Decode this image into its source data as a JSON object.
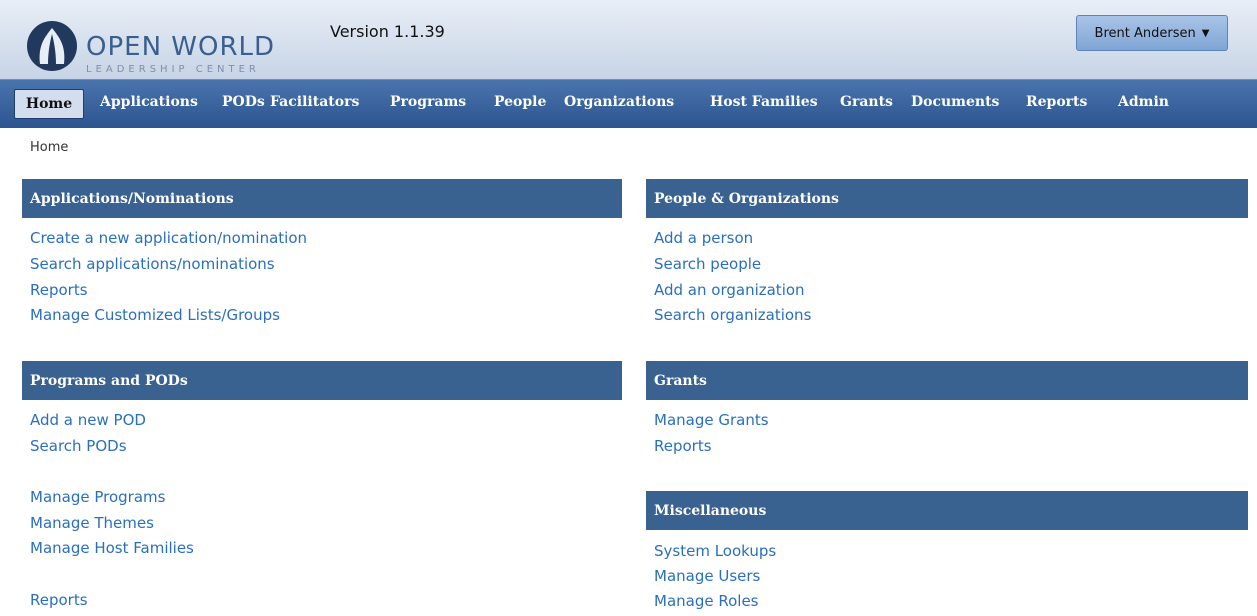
{
  "header": {
    "logo_title": "OPEN WORLD",
    "logo_subtitle": "LEADERSHIP CENTER",
    "version": "Version 1.1.39",
    "user_menu": "Brent Andersen"
  },
  "nav": {
    "items": [
      "Home",
      "Applications",
      "PODs",
      "Facilitators",
      "Programs",
      "People",
      "Organizations",
      "Host Families",
      "Grants",
      "Documents",
      "Reports",
      "Admin"
    ]
  },
  "breadcrumb": "Home",
  "sections": {
    "applications": {
      "title": "Applications/Nominations",
      "links": [
        "Create a new application/nomination",
        "Search applications/nominations",
        "Reports",
        "Manage Customized Lists/Groups"
      ]
    },
    "programs": {
      "title": "Programs and PODs",
      "links": [
        "Add a new POD",
        "Search PODs",
        "Manage Programs",
        "Manage Themes",
        "Manage Host Families",
        "Reports"
      ]
    },
    "people": {
      "title": "People & Organizations",
      "links": [
        "Add a person",
        "Search people",
        "Add an organization",
        "Search organizations"
      ]
    },
    "grants": {
      "title": "Grants",
      "links": [
        "Manage Grants",
        "Reports"
      ]
    },
    "misc": {
      "title": "Miscellaneous",
      "links": [
        "System Lookups",
        "Manage Users",
        "Manage Roles"
      ]
    }
  },
  "colors": {
    "nav_bar": "#3a6291",
    "section_header": "#3a6291",
    "link": "#2a6fbf"
  }
}
